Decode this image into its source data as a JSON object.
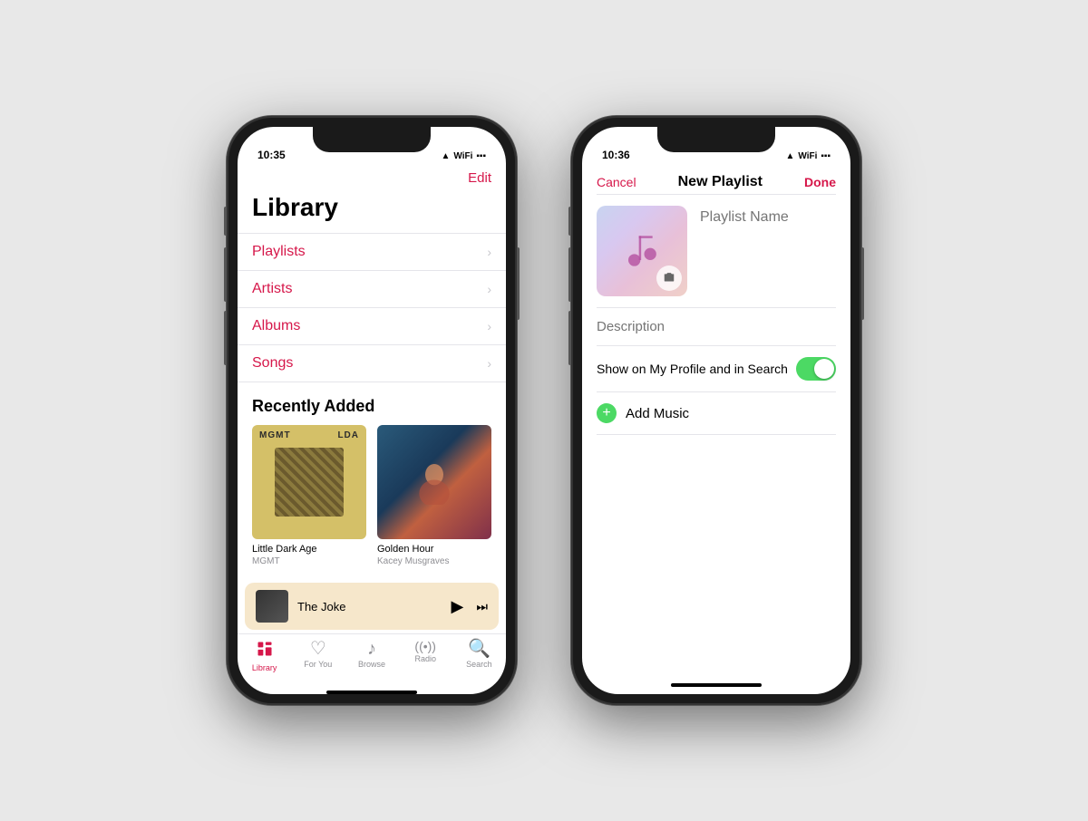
{
  "phone1": {
    "status": {
      "time": "10:35",
      "signal": "▲",
      "wifi": "WiFi",
      "battery": "Batt"
    },
    "header": {
      "edit_label": "Edit",
      "title": "Library"
    },
    "menu_items": [
      {
        "label": "Playlists",
        "id": "playlists"
      },
      {
        "label": "Artists",
        "id": "artists"
      },
      {
        "label": "Albums",
        "id": "albums"
      },
      {
        "label": "Songs",
        "id": "songs"
      }
    ],
    "recently_added_title": "Recently Added",
    "albums": [
      {
        "name": "Little Dark Age",
        "artist": "MGMT",
        "type": "mgmt"
      },
      {
        "name": "Golden Hour",
        "artist": "Kacey Musgraves",
        "type": "kacey"
      }
    ],
    "now_playing": {
      "title": "The Joke",
      "play_icon": "▶",
      "skip_icon": "⏭"
    },
    "tabs": [
      {
        "label": "Library",
        "icon": "📚",
        "active": true
      },
      {
        "label": "For You",
        "icon": "♡",
        "active": false
      },
      {
        "label": "Browse",
        "icon": "♪",
        "active": false
      },
      {
        "label": "Radio",
        "icon": "📡",
        "active": false
      },
      {
        "label": "Search",
        "icon": "🔍",
        "active": false
      }
    ]
  },
  "phone2": {
    "status": {
      "time": "10:36"
    },
    "nav": {
      "cancel_label": "Cancel",
      "title": "New Playlist",
      "done_label": "Done"
    },
    "playlist_name_placeholder": "Playlist Name",
    "description_placeholder": "Description",
    "toggle": {
      "label": "Show on My Profile and in Search",
      "enabled": true
    },
    "add_music_label": "Add Music"
  }
}
